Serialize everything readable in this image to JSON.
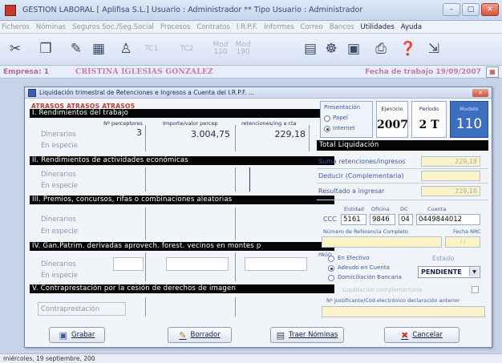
{
  "window": {
    "title": "GESTION LABORAL [ Aplifisa S.L.] Usuario : Administrador ** Tipo Usuario : Administrador",
    "buttons": {
      "minimize": "–",
      "maximize": "□",
      "close": "✕"
    }
  },
  "menu": {
    "items": [
      {
        "label": "Ficheros",
        "active": false
      },
      {
        "label": "Nóminas",
        "active": false
      },
      {
        "label": "Seguros Soc./Seg.Social",
        "active": false
      },
      {
        "label": "Procesos",
        "active": false
      },
      {
        "label": "Contratos",
        "active": false
      },
      {
        "label": "I.R.P.F.",
        "active": false
      },
      {
        "label": "Informes",
        "active": false
      },
      {
        "label": "Correo",
        "active": false
      },
      {
        "label": "Bancos",
        "active": false
      },
      {
        "label": "Utilidades",
        "active": true
      },
      {
        "label": "Ayuda",
        "active": true
      }
    ]
  },
  "toolbar": {
    "icons": [
      "scissors-icon",
      "documents-icon",
      "edit-icon",
      "calculator-icon",
      "person-icon",
      "tc1-icon",
      "tc2-icon",
      "mod110-icon",
      "mod190-icon",
      "cards-icon",
      "network-icon",
      "monitor-icon",
      "printer-icon",
      "help-icon",
      "exit-icon"
    ],
    "tc1": "TC1",
    "tc2": "TC2",
    "mod110": "Mod\n110",
    "mod190": "Mod\n190"
  },
  "empresa": {
    "label": "Empresa:",
    "code": "1",
    "name": "CRISTINA IGLESIAS GONZALEZ",
    "fecha_label": "Fecha de trabajo",
    "fecha_value": "19/09/2007"
  },
  "dialog": {
    "title": "Liquidación trimestral de Retenciones e Ingresos a Cuenta del I.R.P.F. ...",
    "atrasos": "ATRASOS ATRASOS ATRASOS",
    "col_headers": {
      "perceptores": "Nº perceptores",
      "importe": "Importe/valor percep",
      "retenciones": "retenciones/ing a cta"
    },
    "sections": [
      {
        "title": "I. Rendimientos del trabajo",
        "row1": "Dinerarios",
        "row2": "En especie",
        "perceptores": "3",
        "importe": "3.004,75",
        "retenciones": "229,18"
      },
      {
        "title": "II. Rendimientos de actividades económicas",
        "row1": "Dinerarios",
        "row2": "En especie"
      },
      {
        "title": "III. Premios, concursos, rifas o combinaciones aleatorias",
        "row1": "Dinerarios",
        "row2": "En especie"
      },
      {
        "title": "IV. Gan.Patrim. derivadas aprovech. forest. vecinos en montes p",
        "row1": "Dinerarios",
        "row2": "En especie"
      },
      {
        "title": "V. Contraprestación por la cesión de derechos de imagen",
        "row1": "Contraprestación"
      }
    ],
    "presentacion": {
      "label": "Presentación",
      "options": [
        "Papel",
        "Internet"
      ],
      "selected": "Internet"
    },
    "ejercicio": {
      "label": "Ejercicio",
      "value": "2007"
    },
    "periodo": {
      "label": "Período",
      "value": "2 T"
    },
    "modelo": {
      "label": "Modelo",
      "value": "110"
    },
    "total": {
      "title": "Total Liquidación",
      "suma_label": "Suma retenciones/ingresos",
      "suma_value": "229,18",
      "deducir_label": "Deducir (Complementaria)",
      "deducir_value": "",
      "resultado_label": "Resultado a ingresar",
      "resultado_value": "229,18"
    },
    "ccc": {
      "label": "CCC",
      "entidad_label": "Entidad",
      "oficina_label": "Oficina",
      "dc_label": "DC",
      "cuenta_label": "Cuenta",
      "entidad": "5161",
      "oficina": "9846",
      "dc": "04",
      "cuenta": "0449844012"
    },
    "nrc": {
      "ref_label": "Número de Referencia Completo",
      "fecha_label": "Fecha NRC",
      "fecha_value": "/ /"
    },
    "pago": {
      "letters": "PAGO",
      "options": [
        "En Efectivo",
        "Adeudo en Cuenta",
        "Domiciliación Bancaria"
      ],
      "selected": "Adeudo en Cuenta"
    },
    "estado": {
      "label": "Estado",
      "value": "PENDIENTE"
    },
    "complementaria_label": "Liquidación complementaria",
    "justificante_label": "Nº Justificante/Cód.electrónico declaración anterior",
    "buttons": {
      "grabar": "Grabar",
      "borrador": "Borrador",
      "traer": "Traer Nóminas",
      "cancelar": "Cancelar"
    }
  },
  "status": {
    "date": "miércoles, 19 septiembre, 200"
  },
  "colors": {
    "section_header": "#050505",
    "modelo_bg": "#3d6fc0",
    "readonly_field": "#fbf3c8",
    "atrasos": "#c0392b",
    "empresa_text": "#c47fa0"
  }
}
